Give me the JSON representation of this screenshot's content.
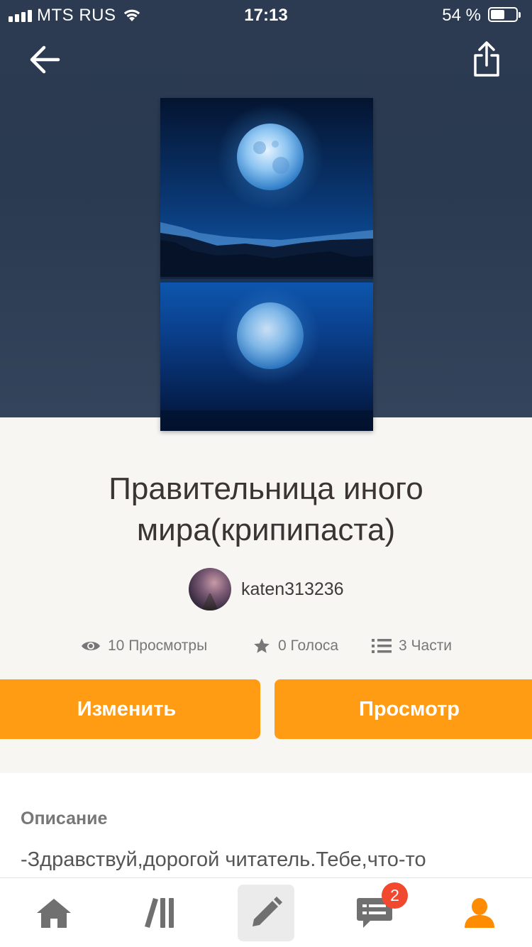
{
  "status_bar": {
    "carrier": "MTS RUS",
    "time": "17:13",
    "battery_percent": "54 %",
    "battery_level": 0.54
  },
  "nav": {
    "back_icon": "arrow-left-icon",
    "share_icon": "share-icon"
  },
  "story": {
    "title_line1": "Правительница иного",
    "title_line2": "мира(крипипаста)",
    "author": "katen313236"
  },
  "stats": {
    "views": "10 Просмотры",
    "votes": "0 Голоса",
    "parts": "3 Части"
  },
  "actions": {
    "edit_label": "Изменить",
    "view_label": "Просмотр"
  },
  "description": {
    "heading": "Описание",
    "text": "-Здравствуй,дорогой читатель.Тебе,что-то"
  },
  "tabbar": {
    "items": [
      {
        "icon": "home-icon"
      },
      {
        "icon": "library-icon"
      },
      {
        "icon": "pencil-icon"
      },
      {
        "icon": "messages-icon"
      },
      {
        "icon": "profile-icon"
      }
    ],
    "messages_badge": "2"
  },
  "colors": {
    "accent": "#ff9c13",
    "badge": "#f1492f",
    "active_tab": "#ff8c00",
    "hero_bg": "#2c3b52"
  }
}
